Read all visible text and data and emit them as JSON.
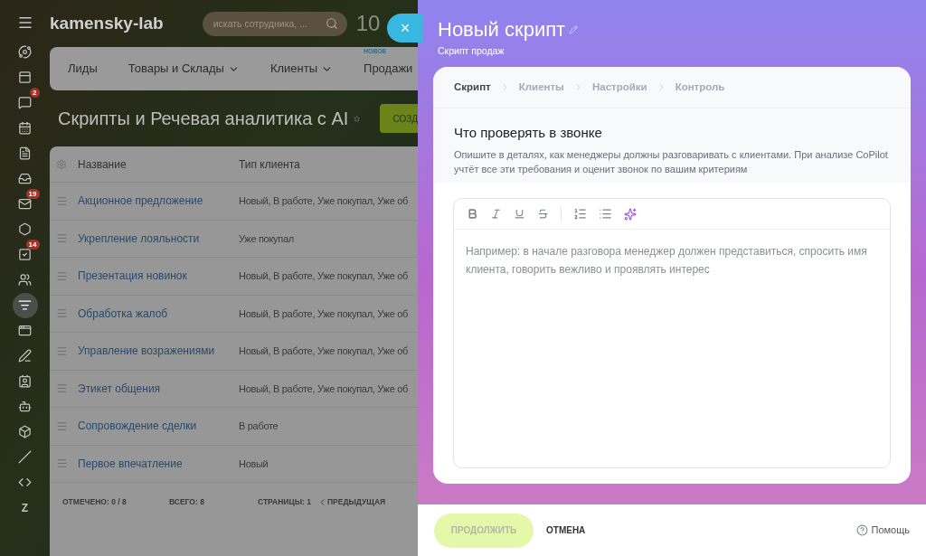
{
  "header": {
    "logo": "kamensky-lab",
    "search": {
      "placeholder": "искать сотрудника, ..."
    },
    "clock": "10",
    "close": "×"
  },
  "sidebar": {
    "items": [
      {
        "kind": "icon",
        "selected": false
      },
      {
        "kind": "icon",
        "selected": false
      },
      {
        "kind": "icon",
        "selected": false,
        "badge": "2"
      },
      {
        "kind": "icon",
        "selected": false
      },
      {
        "kind": "icon",
        "selected": false
      },
      {
        "kind": "icon",
        "selected": false
      },
      {
        "kind": "icon",
        "selected": false,
        "badge": "19"
      },
      {
        "kind": "icon",
        "selected": false
      },
      {
        "kind": "icon",
        "selected": false,
        "badge": "14"
      },
      {
        "kind": "icon",
        "selected": false
      },
      {
        "kind": "icon",
        "selected": true
      },
      {
        "kind": "icon",
        "selected": false
      },
      {
        "kind": "icon",
        "selected": false
      },
      {
        "kind": "icon",
        "selected": false
      },
      {
        "kind": "icon",
        "selected": false
      },
      {
        "kind": "icon",
        "selected": false
      },
      {
        "kind": "icon",
        "selected": false
      },
      {
        "kind": "icon",
        "selected": false
      },
      {
        "kind": "letter",
        "label": "Z",
        "selected": false
      }
    ]
  },
  "nav": [
    {
      "label": "Лиды",
      "dropdown": false
    },
    {
      "label": "Товары и Склады",
      "dropdown": true
    },
    {
      "label": "Клиенты",
      "dropdown": true
    },
    {
      "label": "Продажи",
      "dropdown": false,
      "tag": "НОВОЕ"
    }
  ],
  "page": {
    "title": "Скрипты и Речевая аналитика с AI",
    "create_button": "СОЗД"
  },
  "table": {
    "columns": [
      "Название",
      "Тип клиента"
    ],
    "rows": [
      {
        "name": "Акционное предложение",
        "client_type": "Новый, В работе, Уже покупал, Уже об"
      },
      {
        "name": "Укрепление лояльности",
        "client_type": "Уже покупал"
      },
      {
        "name": "Презентация новинок",
        "client_type": "Новый, В работе, Уже покупал, Уже об"
      },
      {
        "name": "Обработка жалоб",
        "client_type": "Новый, В работе, Уже покупал, Уже об"
      },
      {
        "name": "Управление возражениями",
        "client_type": "Новый, В работе, Уже покупал, Уже об"
      },
      {
        "name": "Этикет общения",
        "client_type": "Новый, В работе, Уже покупал, Уже об"
      },
      {
        "name": "Сопровождение сделки",
        "client_type": "В работе"
      },
      {
        "name": "Первое впечатление",
        "client_type": "Новый"
      }
    ],
    "footer": {
      "checked_label": "ОТМЕЧЕНО:",
      "checked_value": "0 / 8",
      "total_label": "ВСЕГО:",
      "total_value": "8",
      "pages_label": "СТРАНИЦЫ:",
      "pages_value": "1",
      "prev": "ПРЕДЫДУЩАЯ"
    }
  },
  "panel": {
    "title": "Новый скрипт",
    "subtitle": "Скрипт продаж",
    "steps": [
      {
        "label": "Скрипт",
        "selected": true
      },
      {
        "label": "Клиенты",
        "selected": false
      },
      {
        "label": "Настройки",
        "selected": false
      },
      {
        "label": "Контроль",
        "selected": false
      }
    ],
    "section_title": "Что проверять в звонке",
    "section_text": "Опишите в деталях, как менеджеры должны разговаривать с клиентами. При анализе CoPilot учтёт все эти требования и оценит звонок по вашим критериям",
    "editor": {
      "placeholder": "Например: в начале разговора менеджер должен представиться, спросить имя клиента, говорить вежливо и проявлять интерес"
    },
    "footer": {
      "continue": {
        "label": "ПРОДОЛЖИТЬ",
        "disabled": true
      },
      "cancel": "ОТМЕНА",
      "help": "Помощь"
    }
  }
}
